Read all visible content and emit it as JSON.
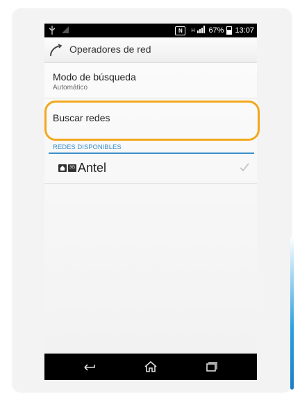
{
  "statusbar": {
    "left_icons": [
      "usb-icon",
      "signal-muted-icon"
    ],
    "nfc_label": "N",
    "network_type": "H",
    "battery_percent": "67%",
    "time": "13:07"
  },
  "actionbar": {
    "title": "Operadores de red",
    "icon": "phone-handset-icon"
  },
  "settings": {
    "search_mode": {
      "title": "Modo de búsqueda",
      "value": "Automático"
    },
    "search_networks": {
      "title": "Buscar redes"
    }
  },
  "available_networks": {
    "header": "REDES DISPONIBLES",
    "items": [
      {
        "badge_home": "home-icon",
        "badge_type": "3G",
        "name": "Antel",
        "selected_icon": "checkmark-icon"
      }
    ]
  },
  "navbar": {
    "buttons": [
      "back-icon",
      "home-icon",
      "recent-apps-icon"
    ]
  },
  "colors": {
    "highlight": "#f2a81d",
    "accent": "#3a8fcb",
    "statusbar_bg": "#000000"
  }
}
